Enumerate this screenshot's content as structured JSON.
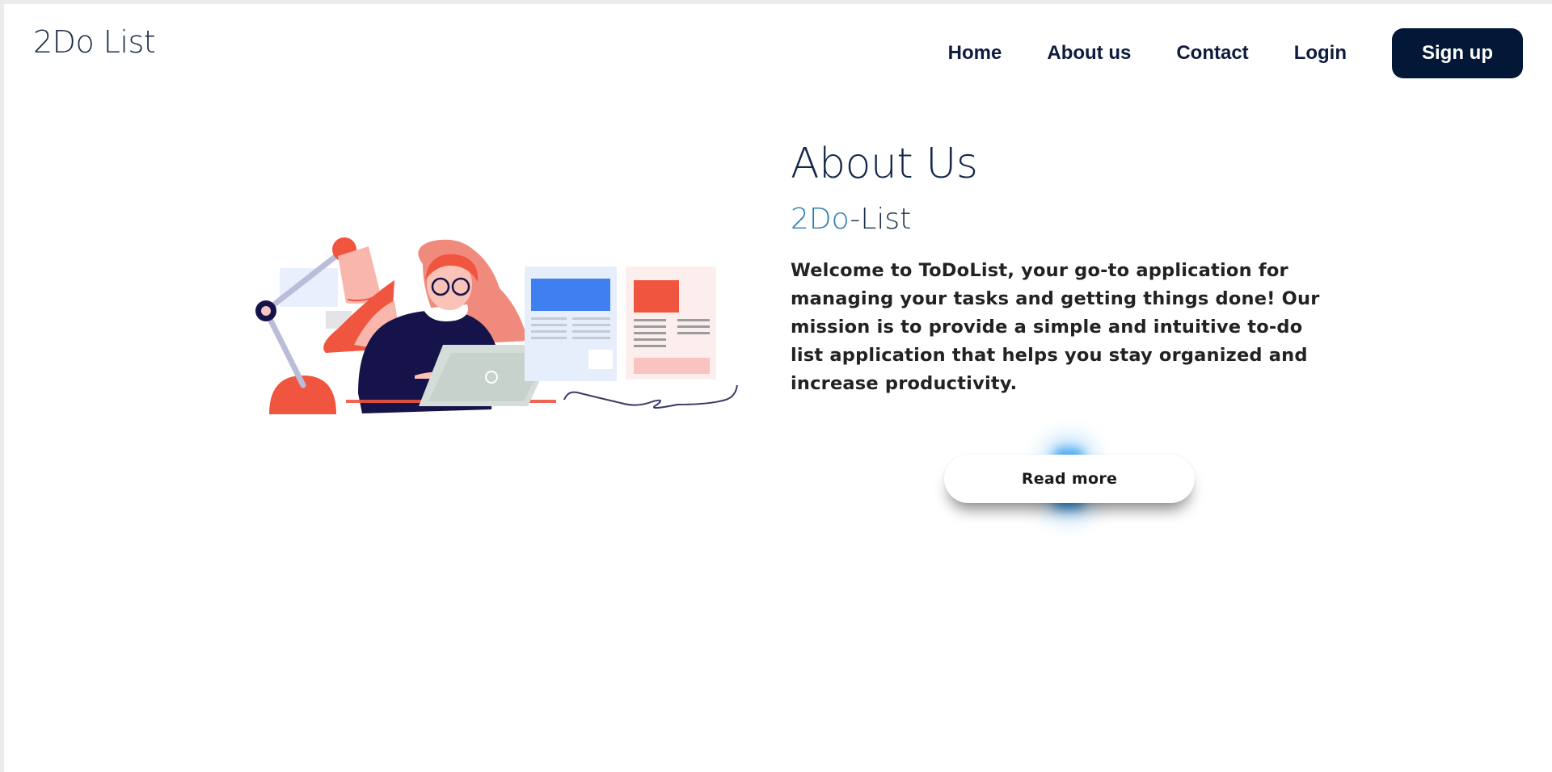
{
  "header": {
    "logo": "2Do List",
    "nav": {
      "home": "Home",
      "about": "About us",
      "contact": "Contact",
      "login": "Login",
      "signup": "Sign up"
    }
  },
  "about": {
    "title": "About Us",
    "subtitle_accent": "2Do",
    "subtitle_rest": "-List",
    "body": "Welcome to ToDoList, your go-to application for managing your tasks and getting things done! Our mission is to provide a simple and intuitive to-do list application that helps you stay organized and increase productivity.",
    "read_more": "Read more"
  },
  "colors": {
    "navy": "#031836",
    "accent_blue": "#2a7bb3",
    "coral": "#f0553f",
    "glow": "#2d9bf0"
  }
}
